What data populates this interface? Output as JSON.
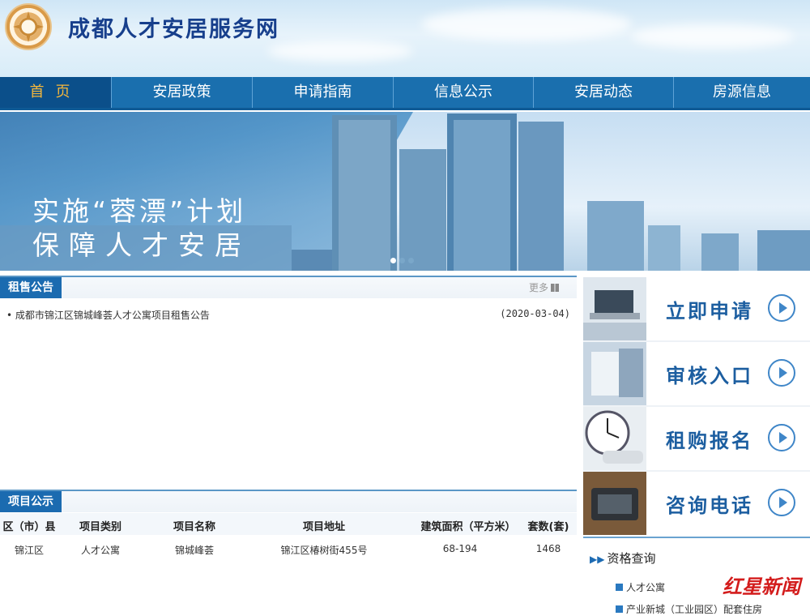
{
  "site": {
    "title": "成都人才安居服务网"
  },
  "nav": {
    "items": [
      "首页",
      "安居政策",
      "申请指南",
      "信息公示",
      "安居动态",
      "房源信息"
    ]
  },
  "banner": {
    "line1": "实施“蓉漂”计划",
    "line2": "保障人才安居"
  },
  "rental": {
    "tag": "租售公告",
    "more": "更多",
    "items": [
      {
        "title": "成都市锦江区锦城峰荟人才公寓项目租售公告",
        "date": "(2020-03-04)"
      }
    ]
  },
  "project": {
    "tag": "项目公示",
    "columns": [
      "区（市）县",
      "项目类别",
      "项目名称",
      "项目地址",
      "建筑面积（平方米）",
      "套数(套)"
    ],
    "rows": [
      [
        "锦江区",
        "人才公寓",
        "锦城峰荟",
        "锦江区椿树街455号",
        "68-194",
        "1468"
      ]
    ]
  },
  "side": {
    "buttons": [
      "立即申请",
      "审核入口",
      "租购报名",
      "咨询电话"
    ],
    "qual_title": "资格查询",
    "links": [
      "人才公寓",
      "产业新城（工业园区）配套住房"
    ]
  },
  "watermark": "红星新闻",
  "colors": {
    "nav": "#1a6fae",
    "nav_active": "#0b4f8a",
    "accent": "#f4b63c",
    "title": "#173f8c"
  }
}
